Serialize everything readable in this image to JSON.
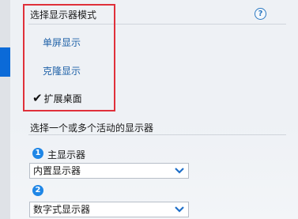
{
  "display_mode": {
    "title": "选择显示器模式",
    "help_glyph": "?",
    "options": [
      {
        "label": "单屏显示",
        "selected": false
      },
      {
        "label": "克隆显示",
        "selected": false
      },
      {
        "label": "扩展桌面",
        "selected": true
      }
    ],
    "check_glyph": "✔"
  },
  "active_displays": {
    "title": "选择一个或多个活动的显示器",
    "displays": [
      {
        "badge": "1",
        "label": "主显示器",
        "selected_value": "内置显示器"
      },
      {
        "badge": "2",
        "selected_value": "数字式显示器"
      }
    ]
  },
  "colors": {
    "accent": "#1f86e6",
    "link": "#2062a8",
    "highlight_box": "#e0303a"
  }
}
